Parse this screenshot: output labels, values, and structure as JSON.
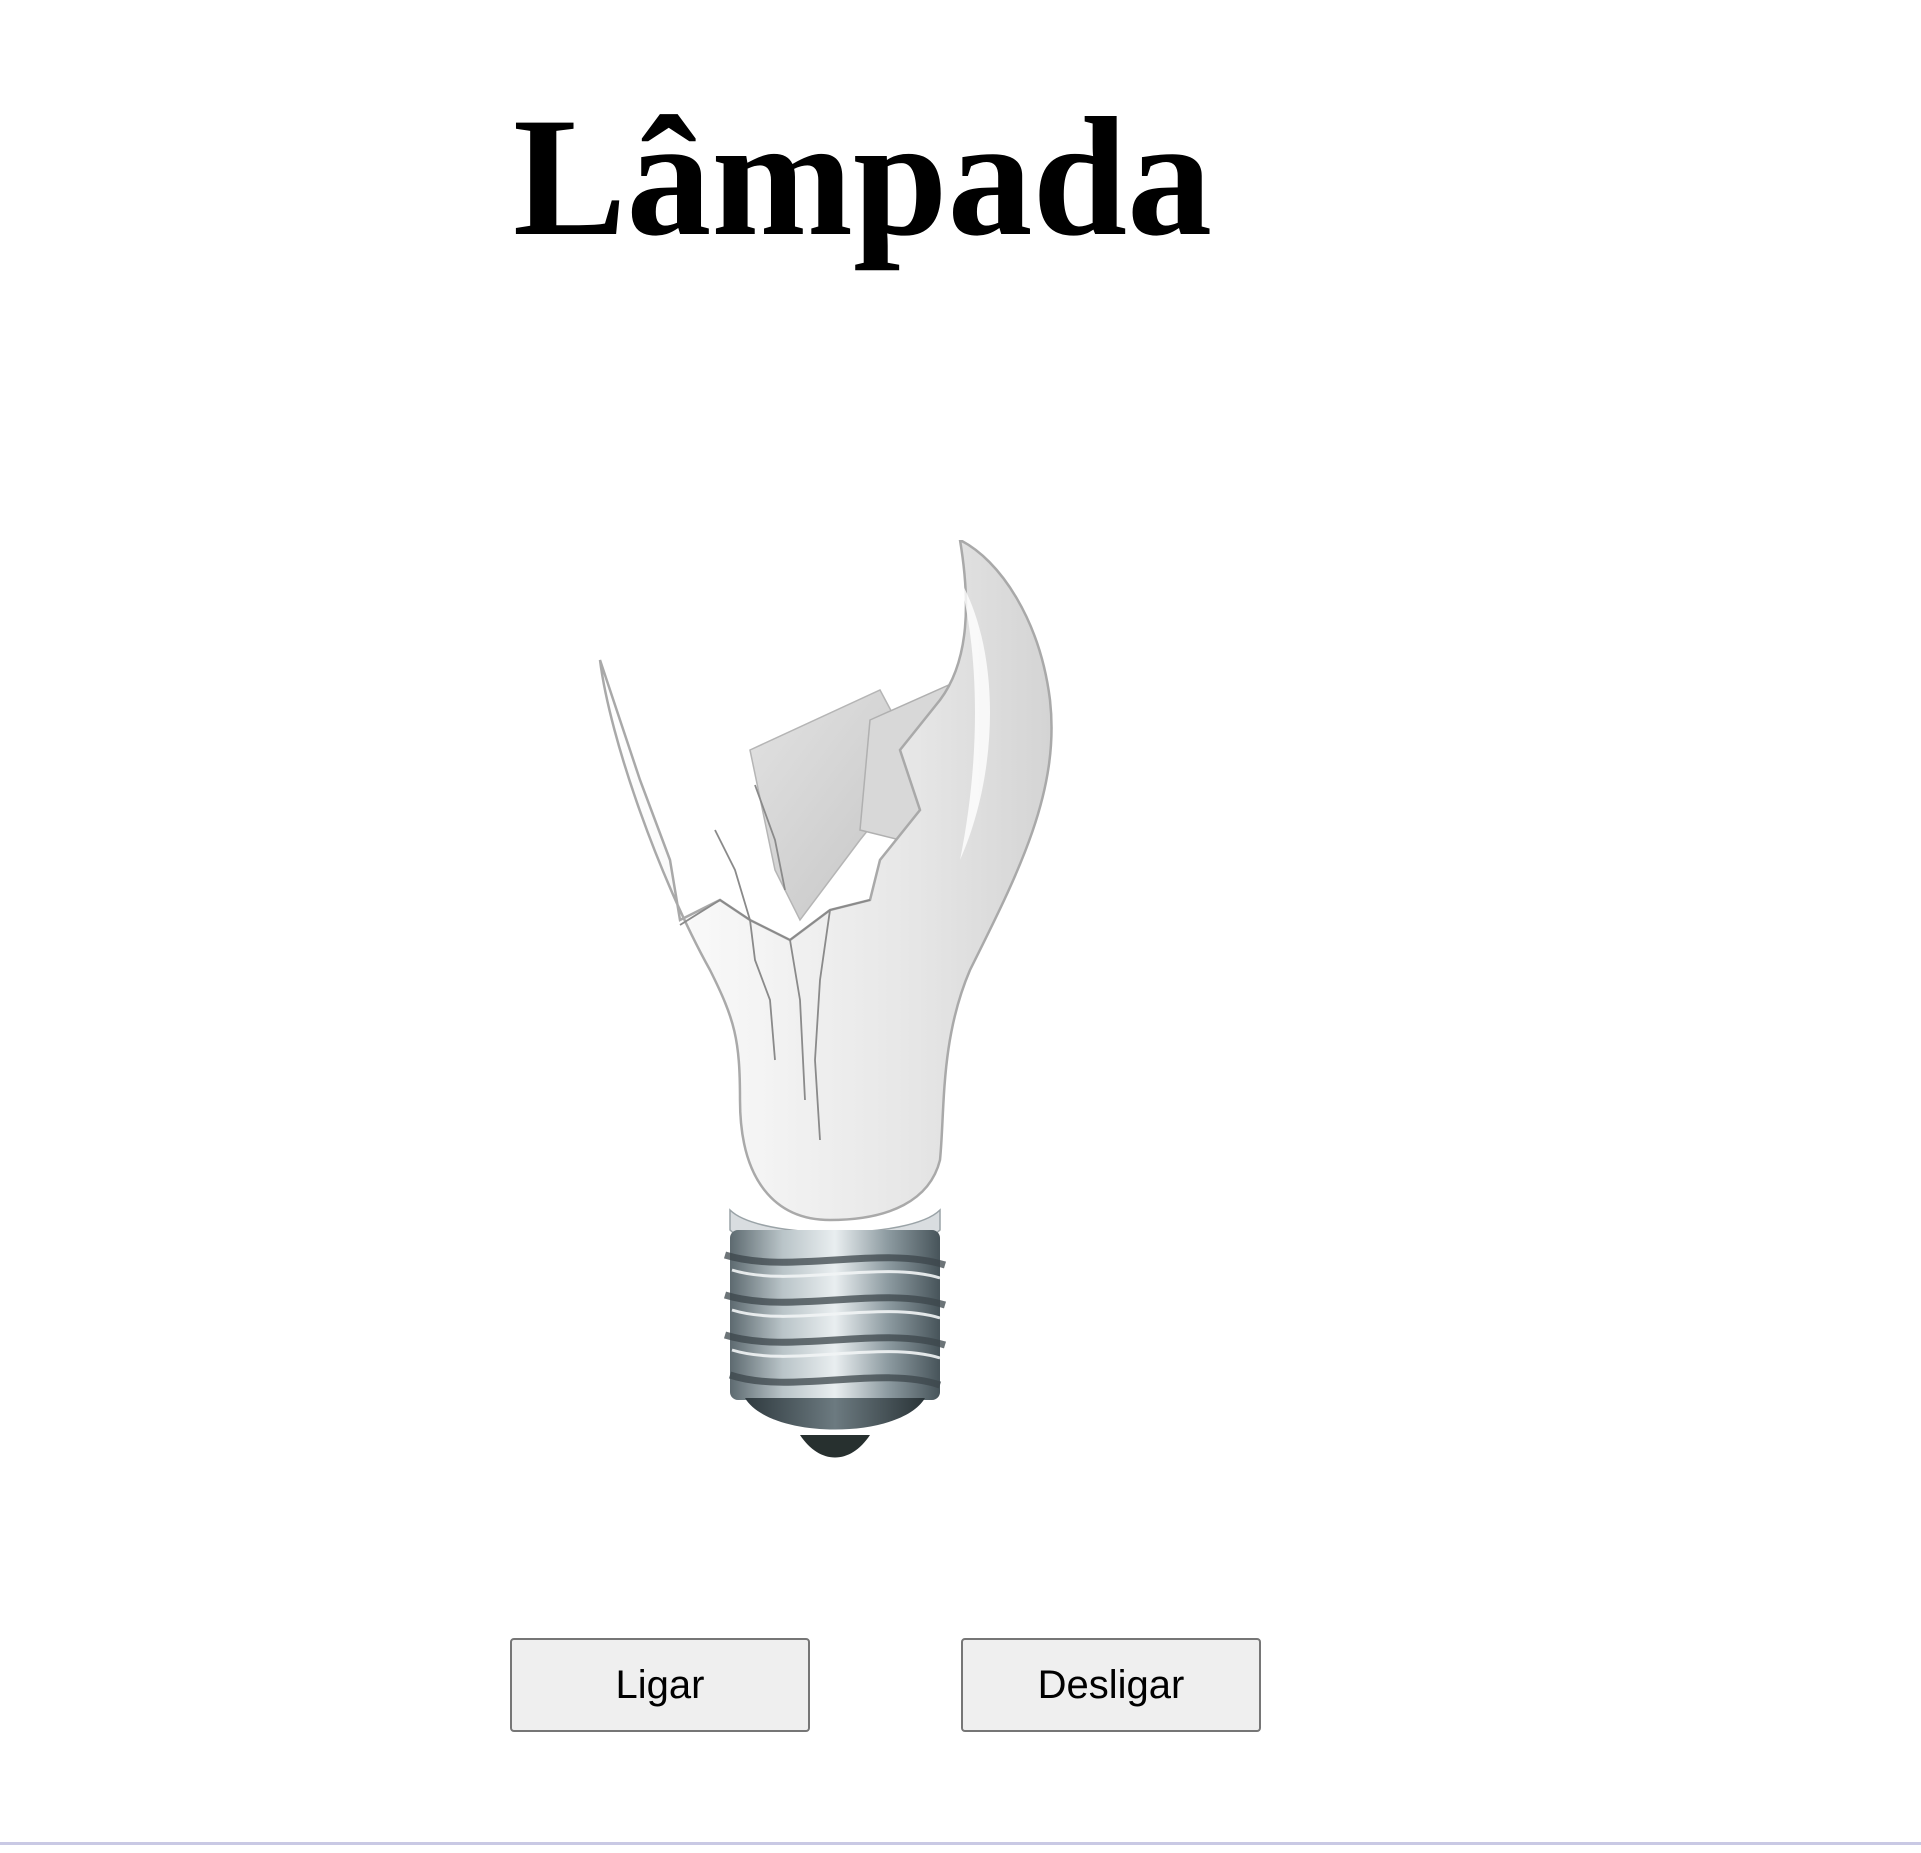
{
  "page": {
    "title": "Lâmpada"
  },
  "lamp": {
    "state": "broken",
    "image_icon": "broken-light-bulb"
  },
  "controls": {
    "on_label": "Ligar",
    "off_label": "Desligar"
  },
  "colors": {
    "background": "#ffffff",
    "title": "#000000",
    "button_bg": "#efefef",
    "button_border": "#767676"
  }
}
